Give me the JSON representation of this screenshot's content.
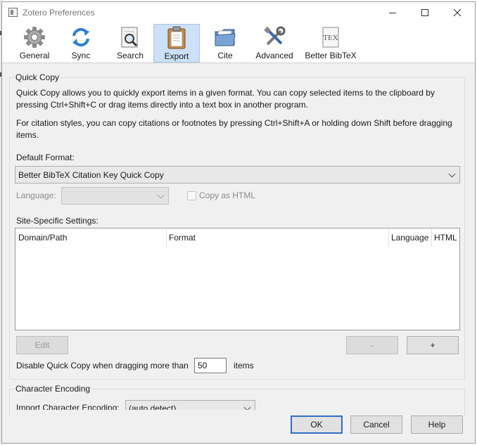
{
  "window": {
    "title": "Zotero Preferences"
  },
  "toolbar": {
    "tabs": [
      {
        "label": "General",
        "icon": "gear-icon"
      },
      {
        "label": "Sync",
        "icon": "sync-icon"
      },
      {
        "label": "Search",
        "icon": "search-document-icon"
      },
      {
        "label": "Export",
        "icon": "clipboard-icon",
        "active": true
      },
      {
        "label": "Cite",
        "icon": "folder-icon"
      },
      {
        "label": "Advanced",
        "icon": "tools-icon"
      },
      {
        "label": "Better BibTeX",
        "icon": "tex-icon"
      }
    ]
  },
  "quick_copy": {
    "legend": "Quick Copy",
    "description_1_line_1": "Quick Copy allows you to quickly export items in a given format. You can copy selected items to the clipboard by",
    "description_1_line_2": "pressing Ctrl+Shift+C or drag items directly into a text box in another program.",
    "description_2_line_1": "For citation styles, you can copy citations or footnotes by pressing Ctrl+Shift+A or holding down Shift before dragging",
    "description_2_line_2": "items.",
    "default_format_label": "Default Format:",
    "default_format_value": "Better BibTeX Citation Key Quick Copy",
    "language_label": "Language:",
    "language_value": "",
    "copy_as_html_label": "Copy as HTML",
    "site_specific_label": "Site-Specific Settings:",
    "table_headers": [
      "Domain/Path",
      "Format",
      "Language",
      "HTML"
    ],
    "table_rows": [],
    "edit_button": "Edit",
    "remove_button": "-",
    "add_button": "+",
    "disable_label": "Disable Quick Copy when dragging more than",
    "disable_value": "50",
    "items_label": "items"
  },
  "character_encoding": {
    "legend": "Character Encoding",
    "import_label": "Import Character Encoding:",
    "import_value": "(auto detect)"
  },
  "footer": {
    "ok_button": "OK",
    "cancel_button": "Cancel",
    "help_button": "Help"
  },
  "colors": {
    "active_tab_bg": "#cce0f7",
    "primary_border": "#2f6fc4",
    "panel_bg": "#f0f0f0"
  }
}
